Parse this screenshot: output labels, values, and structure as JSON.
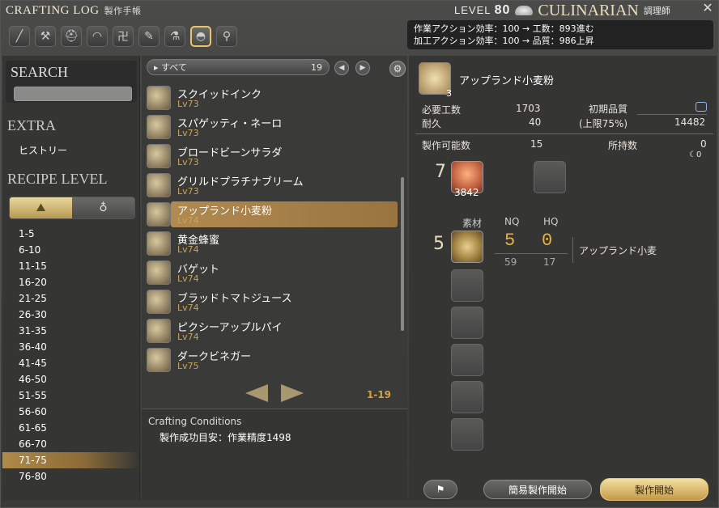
{
  "header": {
    "title": "CRAFTING LOG",
    "title_sub": "製作手帳",
    "level_label": "LEVEL",
    "level_value": "80",
    "job_name": "CULINARIAN",
    "job_sub": "調理師",
    "close_icon": "close-icon"
  },
  "efficiency": {
    "line1": "作業アクション効率：100 → 工数：893進む",
    "line2": "加工アクション効率：100 → 品質：986上昇"
  },
  "tabs": [
    {
      "name": "carpenter-icon",
      "glyph": "╱"
    },
    {
      "name": "blacksmith-icon",
      "glyph": "⚒"
    },
    {
      "name": "armorer-icon",
      "glyph": "⛑"
    },
    {
      "name": "goldsmith-icon",
      "glyph": "◠"
    },
    {
      "name": "leatherworker-icon",
      "glyph": "卍"
    },
    {
      "name": "weaver-icon",
      "glyph": "✎"
    },
    {
      "name": "alchemist-icon",
      "glyph": "⚗"
    },
    {
      "name": "culinarian-icon",
      "glyph": "◓"
    },
    {
      "name": "search-icon",
      "glyph": "⚲"
    }
  ],
  "left": {
    "search_label": "SEARCH",
    "extra_label": "EXTRA",
    "history": "ヒストリー",
    "recipe_level_label": "RECIPE LEVEL",
    "toggle_left_icon": "level-icon",
    "toggle_right_icon": "bag-icon",
    "levels": [
      "1-5",
      "6-10",
      "11-15",
      "16-20",
      "21-25",
      "26-30",
      "31-35",
      "36-40",
      "41-45",
      "46-50",
      "51-55",
      "56-60",
      "61-65",
      "66-70",
      "71-75",
      "76-80"
    ],
    "selected_level": "71-75"
  },
  "middle": {
    "filter_label": "すべて",
    "filter_count": "19",
    "recipes": [
      {
        "name": "スクイッドインク",
        "level": "Lv73"
      },
      {
        "name": "スパゲッティ・ネーロ",
        "level": "Lv73"
      },
      {
        "name": "ブロードビーンサラダ",
        "level": "Lv73"
      },
      {
        "name": "グリルドプラチナブリーム",
        "level": "Lv73"
      },
      {
        "name": "アップランド小麦粉",
        "level": "Lv74"
      },
      {
        "name": "黄金蜂蜜",
        "level": "Lv74"
      },
      {
        "name": "バゲット",
        "level": "Lv74"
      },
      {
        "name": "ブラッドトマトジュース",
        "level": "Lv74"
      },
      {
        "name": "ピクシーアップルパイ",
        "level": "Lv74"
      },
      {
        "name": "ダークビネガー",
        "level": "Lv75"
      }
    ],
    "selected_index": 4,
    "pager": "1-19",
    "conditions_title": "Crafting Conditions",
    "conditions_value": "製作成功目安：作業精度1498"
  },
  "right": {
    "item_name": "アップランド小麦粉",
    "item_qty": "3",
    "req_progress_label": "必要工数",
    "req_progress_value": "1703",
    "durability_label": "耐久",
    "durability_value": "40",
    "init_quality_label": "初期品質",
    "quality_cap_label": "(上限75%)",
    "quality_max": "14482",
    "craftable_label": "製作可能数",
    "craftable_value": "15",
    "owned_label": "所持数",
    "owned_value": "0",
    "owned_hq": "0",
    "crystal_req": "7",
    "crystal_have": "3842",
    "mat_header": "素材",
    "nq_header": "NQ",
    "hq_header": "HQ",
    "mat_req": "5",
    "mat_nq": "5",
    "mat_hq": "0",
    "mat_nq_have": "59",
    "mat_hq_have": "17",
    "mat_name": "アップランド小麦",
    "btn_quick": "簡易製作開始",
    "btn_craft": "製作開始"
  }
}
